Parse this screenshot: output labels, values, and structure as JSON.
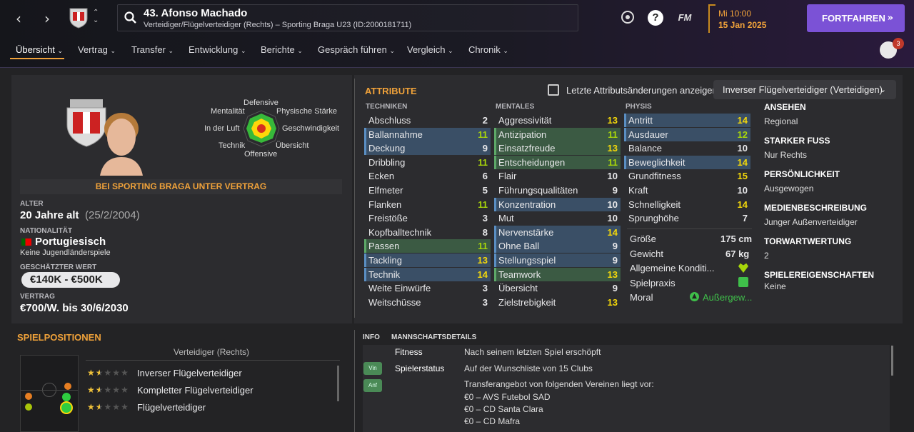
{
  "header": {
    "player_title": "43. Afonso Machado",
    "player_subtitle": "Verteidiger/Flügelverteidiger (Rechts) – Sporting Braga U23 (ID:2000181711)",
    "fm_label": "FM",
    "time": "Mi 10:00",
    "date": "15 Jan 2025",
    "continue_label": "FORTFAHREN",
    "notification_count": "3",
    "help_label": "?"
  },
  "menu": [
    "Übersicht",
    "Vertrag",
    "Transfer",
    "Entwicklung",
    "Berichte",
    "Gespräch führen",
    "Vergleich",
    "Chronik"
  ],
  "profile": {
    "radar_labels": {
      "top": "Defensive",
      "top_left": "Mentalität",
      "top_right": "Physische Stärke",
      "left": "In der Luft",
      "right": "Geschwindigkeit",
      "bottom_left": "Technik",
      "bottom_right": "Übersicht",
      "bottom": "Offensive"
    },
    "contract_banner": "BEI SPORTING BRAGA UNTER VERTRAG",
    "age_label": "ALTER",
    "age": "20 Jahre alt",
    "birthdate": "(25/2/2004)",
    "nationality_label": "NATIONALITÄT",
    "nationality": "Portugiesisch",
    "youth_caps": "Keine Jugendländerspiele",
    "value_label": "GESCHÄTZTER WERT",
    "value": "€140K - €500K",
    "contract_label": "VERTRAG",
    "contract": "€700/W. bis 30/6/2030"
  },
  "attributes": {
    "title": "ATTRIBUTE",
    "checkbox_label": "Letzte Attributsänderungen anzeigen",
    "role_select": "Inverser Flügelverteidiger (Verteidigen)",
    "col_technical": "TECHNIKEN",
    "col_mental": "MENTALES",
    "col_physical": "PHYSIS",
    "technical": [
      {
        "name": "Abschluss",
        "value": "2",
        "hl": ""
      },
      {
        "name": "Ballannahme",
        "value": "11",
        "hl": "blue"
      },
      {
        "name": "Deckung",
        "value": "9",
        "hl": "blue"
      },
      {
        "name": "Dribbling",
        "value": "11",
        "hl": ""
      },
      {
        "name": "Ecken",
        "value": "6",
        "hl": ""
      },
      {
        "name": "Elfmeter",
        "value": "5",
        "hl": ""
      },
      {
        "name": "Flanken",
        "value": "11",
        "hl": ""
      },
      {
        "name": "Freistöße",
        "value": "3",
        "hl": ""
      },
      {
        "name": "Kopfballtechnik",
        "value": "8",
        "hl": ""
      },
      {
        "name": "Passen",
        "value": "11",
        "hl": "green"
      },
      {
        "name": "Tackling",
        "value": "13",
        "hl": "blue"
      },
      {
        "name": "Technik",
        "value": "14",
        "hl": "blue"
      },
      {
        "name": "Weite Einwürfe",
        "value": "3",
        "hl": ""
      },
      {
        "name": "Weitschüsse",
        "value": "3",
        "hl": ""
      }
    ],
    "mental": [
      {
        "name": "Aggressivität",
        "value": "13",
        "hl": ""
      },
      {
        "name": "Antizipation",
        "value": "11",
        "hl": "green"
      },
      {
        "name": "Einsatzfreude",
        "value": "13",
        "hl": "green"
      },
      {
        "name": "Entscheidungen",
        "value": "11",
        "hl": "green"
      },
      {
        "name": "Flair",
        "value": "10",
        "hl": ""
      },
      {
        "name": "Führungsqualitäten",
        "value": "9",
        "hl": ""
      },
      {
        "name": "Konzentration",
        "value": "10",
        "hl": "blue"
      },
      {
        "name": "Mut",
        "value": "10",
        "hl": ""
      },
      {
        "name": "Nervenstärke",
        "value": "14",
        "hl": "blue"
      },
      {
        "name": "Ohne Ball",
        "value": "9",
        "hl": "blue"
      },
      {
        "name": "Stellungsspiel",
        "value": "9",
        "hl": "blue"
      },
      {
        "name": "Teamwork",
        "value": "13",
        "hl": "green"
      },
      {
        "name": "Übersicht",
        "value": "9",
        "hl": ""
      },
      {
        "name": "Zielstrebigkeit",
        "value": "13",
        "hl": ""
      }
    ],
    "physical": [
      {
        "name": "Antritt",
        "value": "14",
        "hl": "blue"
      },
      {
        "name": "Ausdauer",
        "value": "12",
        "hl": "blue"
      },
      {
        "name": "Balance",
        "value": "10",
        "hl": ""
      },
      {
        "name": "Beweglichkeit",
        "value": "14",
        "hl": "blue"
      },
      {
        "name": "Grundfitness",
        "value": "15",
        "hl": ""
      },
      {
        "name": "Kraft",
        "value": "10",
        "hl": ""
      },
      {
        "name": "Schnelligkeit",
        "value": "14",
        "hl": ""
      },
      {
        "name": "Sprunghöhe",
        "value": "7",
        "hl": ""
      }
    ],
    "height_label": "Größe",
    "height": "175 cm",
    "weight_label": "Gewicht",
    "weight": "67 kg",
    "condition_label": "Allgemeine Konditi...",
    "match_practice_label": "Spielpraxis",
    "morale_label": "Moral",
    "morale": "Außergew..."
  },
  "right_panel": [
    {
      "label": "ANSEHEN",
      "value": "Regional"
    },
    {
      "label": "STARKER FUSS",
      "value": "Nur Rechts"
    },
    {
      "label": "PERSÖNLICHKEIT",
      "value": "Ausgewogen"
    },
    {
      "label": "MEDIENBESCHREIBUNG",
      "value": "Junger Außenverteidiger"
    },
    {
      "label": "TORWARTWERTUNG",
      "value": "2"
    },
    {
      "label": "SPIELEREIGENSCHAFTEN",
      "value": "Keine"
    }
  ],
  "positions": {
    "title": "SPIELPOSITIONEN",
    "subtitle": "Verteidiger (Rechts)",
    "roles": [
      {
        "name": "Inverser Flügelverteidiger",
        "stars": 1.5
      },
      {
        "name": "Kompletter Flügelverteidiger",
        "stars": 1.5
      },
      {
        "name": "Flügelverteidiger",
        "stars": 1.5
      }
    ]
  },
  "info": {
    "tab_info": "INFO",
    "tab_team": "MANNSCHAFTSDETAILS",
    "fitness_label": "Fitness",
    "fitness": "Nach seinem letzten Spiel erschöpft",
    "status_label": "Spielerstatus",
    "status": "Auf der Wunschliste von 15 Clubs",
    "transfer_intro": "Transferangebot von folgenden Vereinen liegt vor:",
    "offers": [
      "€0 – AVS Futebol SAD",
      "€0 – CD Santa Clara",
      "€0 – CD Mafra"
    ],
    "tag1": "Vin",
    "tag2": "Anf"
  },
  "colors": {
    "accent": "#f0a23a",
    "purple": "#7b52d6",
    "blue_hl": "#3a4f66",
    "green_hl": "#3b5a43"
  }
}
